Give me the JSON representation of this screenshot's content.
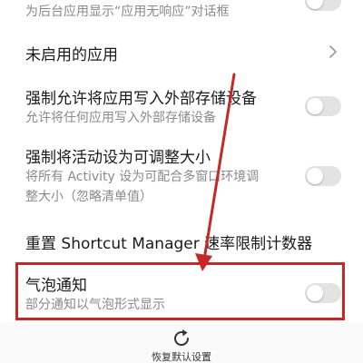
{
  "settings": {
    "top_item": {
      "description": "为后台应用显示“应用无响应”对话框",
      "toggle_on": false
    },
    "inactive_apps": {
      "title": "未启用的应用"
    },
    "force_external_storage": {
      "title": "强制允许将应用写入外部存储设备",
      "description": "允许将任何应用写入外部存储设备",
      "toggle_on": false
    },
    "force_resizable": {
      "title": "强制将活动设为可调整大小",
      "description_line1": "将所有 Activity 设为可配合多窗口环境调",
      "description_line2": "整大小（忽略清单值）",
      "toggle_on": false
    },
    "reset_shortcut": {
      "title": "重置 Shortcut Manager 速率限制计数器"
    },
    "bubble_notifications": {
      "title": "气泡通知",
      "description": "部分通知以气泡形式显示",
      "toggle_on": false
    }
  },
  "bottom_bar": {
    "restore_label": "恢复默认设置",
    "icon": "refresh-icon"
  },
  "colors": {
    "highlight": "#c62828",
    "toggle_off": "#e3e3e3"
  }
}
